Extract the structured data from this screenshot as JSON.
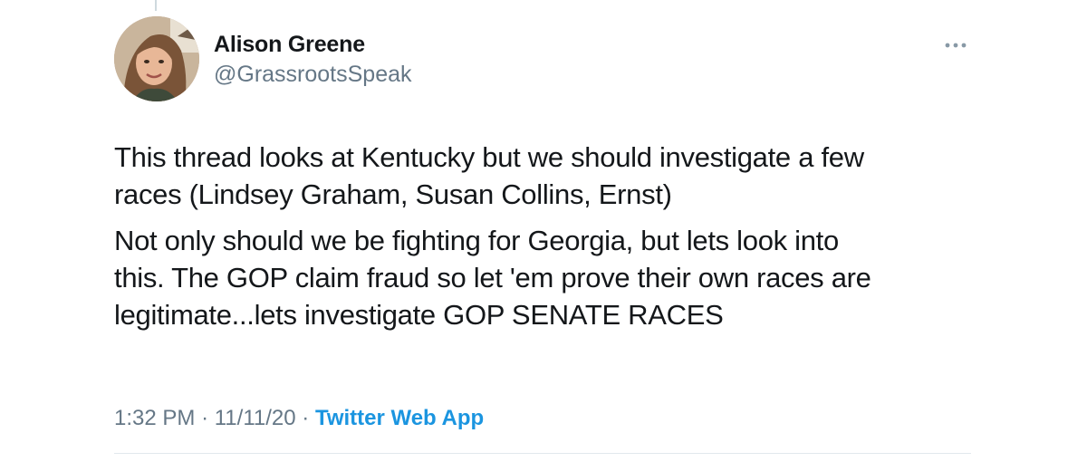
{
  "author": {
    "name": "Alison Greene",
    "handle": "@GrassrootsSpeak",
    "avatar_icon": "avatar-photo"
  },
  "tweet": {
    "paragraphs": [
      "This thread looks at Kentucky but we should investigate a few\nraces (Lindsey Graham, Susan Collins, Ernst)",
      "Not only should we be fighting for Georgia, but lets look into\nthis. The GOP claim fraud so let 'em prove their own races are\nlegitimate...lets investigate GOP SENATE RACES"
    ]
  },
  "meta": {
    "time": "1:32 PM",
    "separator": "·",
    "date": "11/11/20",
    "source": "Twitter Web App"
  },
  "menu": {
    "icon": "more-options-icon"
  },
  "colors": {
    "text": "#14171a",
    "muted": "#657786",
    "link": "#1b95e0",
    "divider": "#e1e8ed"
  }
}
